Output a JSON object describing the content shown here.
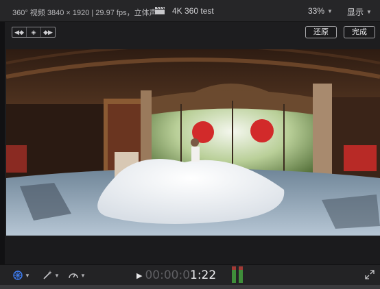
{
  "header": {
    "clip_info": "360° 视频 3840 × 1920 | 29.97 fps，立体声",
    "project_icon": "clapperboard-icon",
    "project_title": "4K 360 test",
    "zoom_label": "33%",
    "view_label": "显示"
  },
  "toolbar": {
    "keyframe_nav": [
      "prev-keyframe-icon",
      "add-keyframe-icon",
      "next-keyframe-icon"
    ],
    "reset_label": "还原",
    "done_label": "完成"
  },
  "viewer": {
    "content": "360-equirectangular-video-frame"
  },
  "playback": {
    "tools": [
      "360-transform-icon",
      "magic-wand-icon",
      "speed-gauge-icon"
    ],
    "timecode_dim": "00:00:0",
    "timecode_bright": "1:22",
    "accent_blue": "#3d7cf2"
  }
}
